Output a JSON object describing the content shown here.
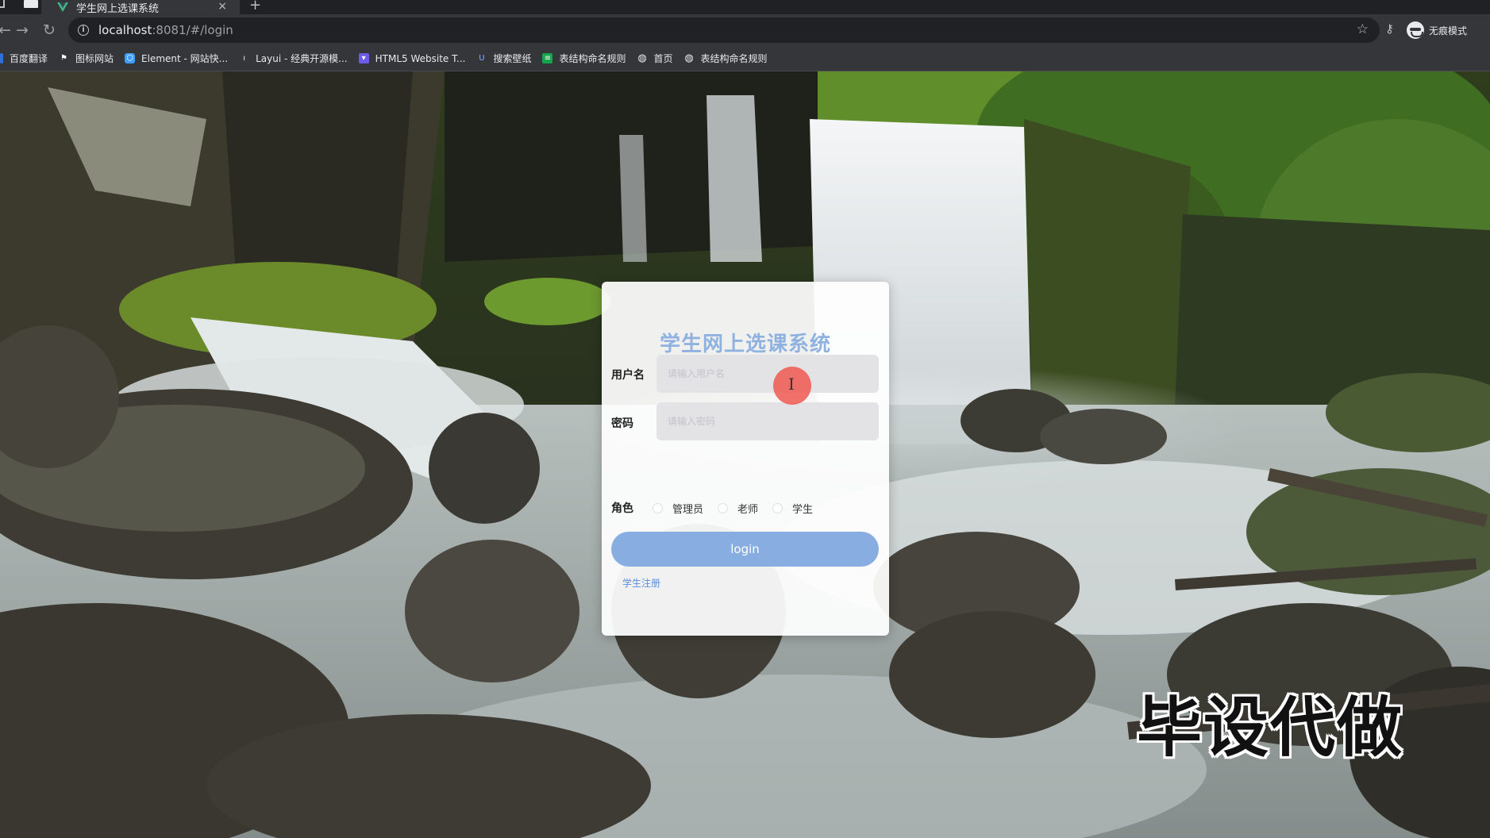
{
  "browser": {
    "tab_title": "学生网上选课系统",
    "tab_close": "×",
    "new_tab": "+",
    "url_host": "localhost",
    "url_path": ":8081/#/login",
    "incognito_label": "无痕模式",
    "icons": [
      "back-icon",
      "forward-icon",
      "reload-icon",
      "info-icon",
      "star-icon",
      "key-icon",
      "incognito-icon"
    ],
    "bookmarks": [
      {
        "label": "百度翻译",
        "color": "#2f6fde"
      },
      {
        "label": "图标网站",
        "color": "#1b1b1b"
      },
      {
        "label": "Element - 网站快...",
        "color": "#409eff"
      },
      {
        "label": "Layui - 经典开源模...",
        "color": "#393d49"
      },
      {
        "label": "HTML5 Website T...",
        "color": "#6c5ce7"
      },
      {
        "label": "搜索壁纸",
        "color": "#3a7bd5"
      },
      {
        "label": "表结构命名规则",
        "color": "#16a34a"
      },
      {
        "label": "首页",
        "color": "#5f6368"
      },
      {
        "label": "表结构命名规则",
        "color": "#5f6368"
      }
    ]
  },
  "login": {
    "title": "学生网上选课系统",
    "username_label": "用户名",
    "username_placeholder": "请输入用户名",
    "password_label": "密码",
    "password_placeholder": "请输入密码",
    "role_label": "角色",
    "roles": [
      "管理员",
      "老师",
      "学生"
    ],
    "submit_label": "login",
    "register_link": "学生注册"
  },
  "overlay": {
    "watermark": "毕设代做",
    "cursor": "I"
  },
  "colors": {
    "accent": "#88aee1",
    "title": "#8fb2e0",
    "link": "#5a8ed6",
    "chrome_dark": "#202124",
    "chrome_toolbar": "#35363a"
  }
}
